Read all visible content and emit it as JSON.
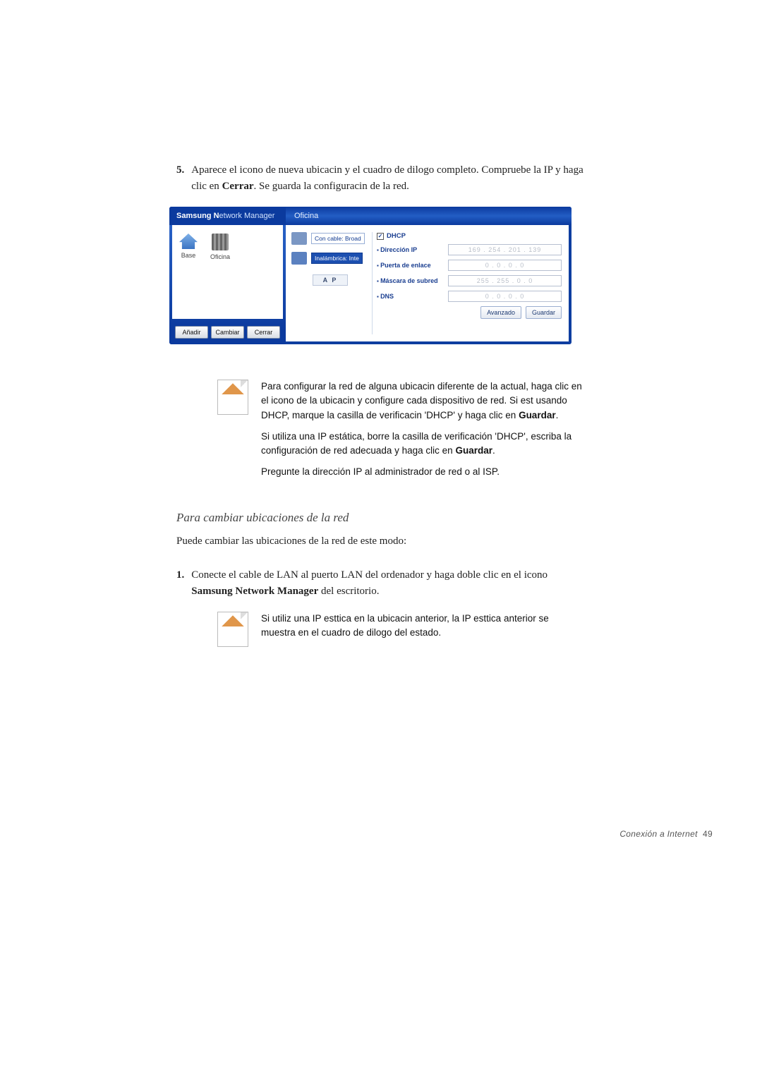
{
  "step5": {
    "num": "5.",
    "text_before": "Aparece el icono de nueva ubicacin y el cuadro de dilogo completo. Compruebe la IP y haga clic en ",
    "bold": "Cerrar",
    "text_after": ". Se guarda la configuracin de la red."
  },
  "app": {
    "title_strong": "Samsung N",
    "title_rest": "etwork Manager",
    "locations": {
      "base": "Base",
      "oficina": "Oficina"
    },
    "bottom_buttons": {
      "add": "Añadir",
      "change": "Cambiar",
      "close": "Cerrar"
    },
    "right_title": "Oficina",
    "devices": {
      "wired": "Con cable: Broad",
      "wireless": "Inalámbrica: Inte",
      "ap": "A P"
    },
    "cfg": {
      "dhcp_label": "DHCP",
      "ip_label": "Dirección IP",
      "gateway_label": "Puerta de enlace",
      "mask_label": "Máscara de subred",
      "dns_label": "DNS",
      "ip_value": "169 . 254 . 201 . 139",
      "zero": "0 . 0 . 0 . 0",
      "mask_value": "255 . 255 . 0 . 0",
      "adv": "Avanzado",
      "save": "Guardar"
    }
  },
  "note1": {
    "p1a": "Para configurar la red de alguna ubicacin diferente de la actual, haga clic en el icono de la ubicacin y configure cada dispositivo de red. Si est usando DHCP, marque la casilla de verificacin 'DHCP' y haga clic en ",
    "p1b": "Guardar",
    "p1c": ".",
    "p2a": "Si utiliza una IP estática, borre la casilla de verificación 'DHCP', escriba la configuración de red adecuada y haga clic en ",
    "p2b": "Guardar",
    "p2c": ".",
    "p3": "Pregunte la dirección IP al administrador de red o al ISP."
  },
  "heading": "Para cambiar ubicaciones de la red",
  "plain": "Puede cambiar las ubicaciones de la red de este modo:",
  "step1": {
    "num": "1.",
    "a": "Conecte el cable de LAN al puerto LAN del ordenador y haga doble clic en el icono ",
    "b": "Samsung Network Manager",
    "c": " del escritorio."
  },
  "note2": {
    "p1": "Si utiliz una IP esttica en la ubicacin anterior, la IP esttica anterior se muestra en el cuadro de dilogo del estado."
  },
  "footer": {
    "label": "Conexión a Internet",
    "page": "49"
  }
}
